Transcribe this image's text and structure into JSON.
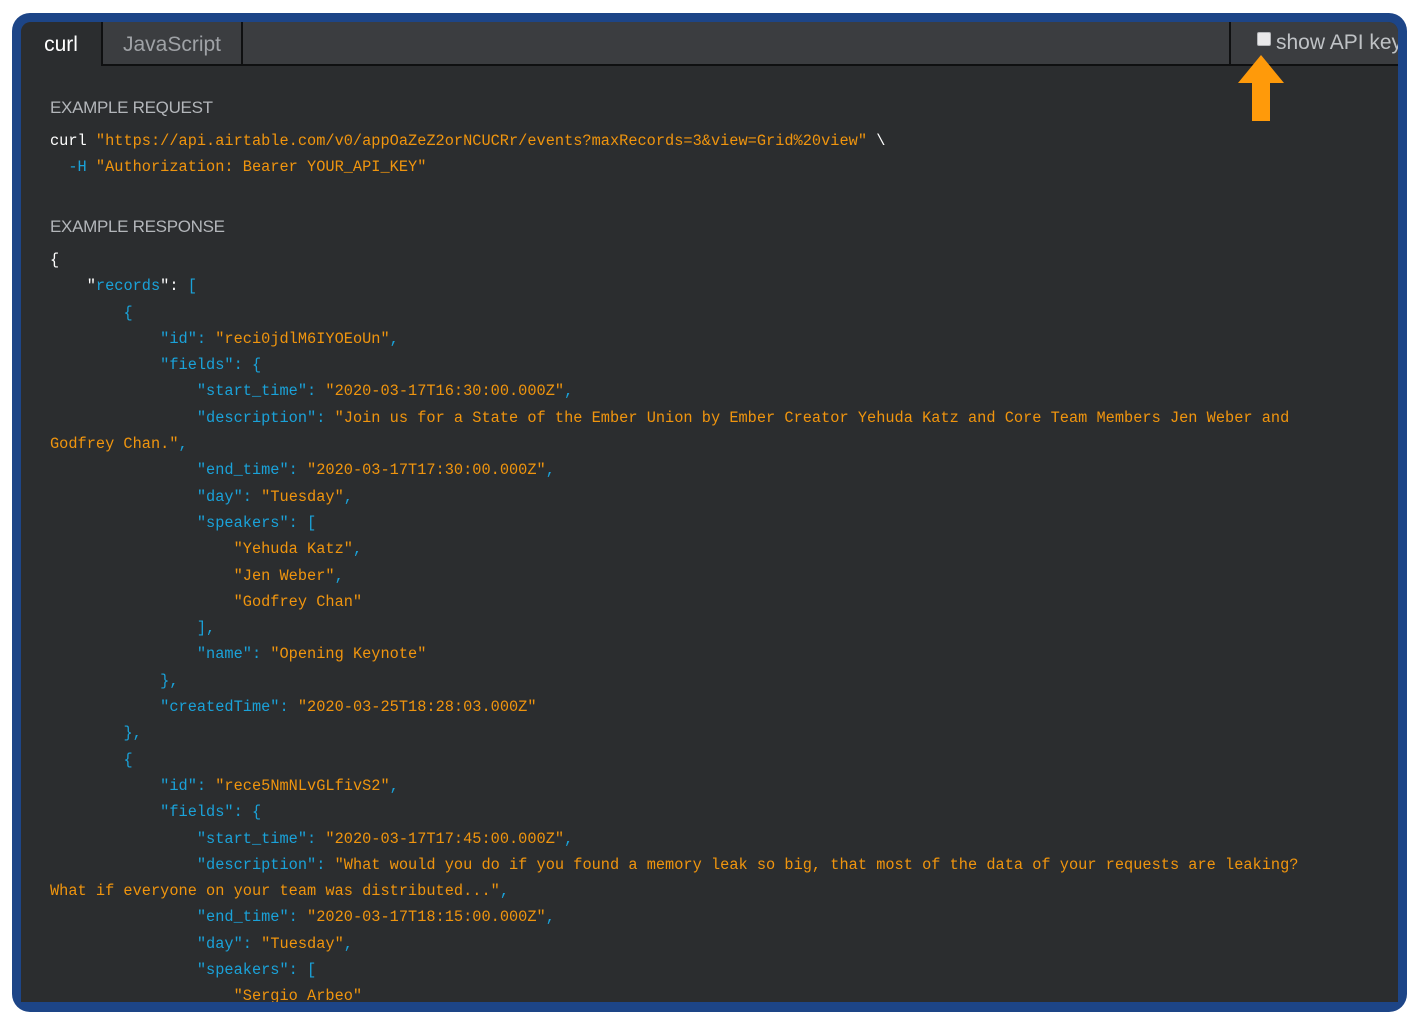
{
  "tabs": [
    {
      "label": "curl",
      "active": true
    },
    {
      "label": "JavaScript",
      "active": false
    }
  ],
  "api_key_toggle": {
    "label": "show API key",
    "checked": false
  },
  "request": {
    "heading": "EXAMPLE REQUEST",
    "command": "curl",
    "url": "\"https://api.airtable.com/v0/appOaZeZ2orNCUCRr/events?maxRecords=3&view=Grid%20view\"",
    "continuation": "\\",
    "header_flag": "-H",
    "header_value": "\"Authorization: Bearer YOUR_API_KEY\""
  },
  "response": {
    "heading": "EXAMPLE RESPONSE",
    "records": [
      {
        "id": "\"reci0jdlM6IYOEoUn\"",
        "start_time": "\"2020-03-17T16:30:00.000Z\"",
        "description_start": "\"Join us for a State of the Ember Union by Ember Creator Yehuda Katz and Core Team Members Jen Weber and",
        "description_end": "Godfrey Chan.\"",
        "end_time": "\"2020-03-17T17:30:00.000Z\"",
        "day": "\"Tuesday\"",
        "speakers": [
          "\"Yehuda Katz\"",
          "\"Jen Weber\"",
          "\"Godfrey Chan\""
        ],
        "name": "\"Opening Keynote\"",
        "createdTime": "\"2020-03-25T18:28:03.000Z\""
      },
      {
        "id": "\"rece5NmNLvGLfivS2\"",
        "start_time": "\"2020-03-17T17:45:00.000Z\"",
        "description_start": "\"What would you do if you found a memory leak so big, that most of the data of your requests are leaking?",
        "description_end": "What if everyone on your team was distributed...\"",
        "end_time": "\"2020-03-17T18:15:00.000Z\"",
        "day": "\"Tuesday\"",
        "speakers": [
          "\"Sergio Arbeo\""
        ]
      }
    ]
  },
  "colors": {
    "key": "#1aa2d9",
    "string": "#f0950e",
    "background": "#2b2d2f",
    "frame": "#1d4587",
    "arrow": "#ff9a0a"
  }
}
